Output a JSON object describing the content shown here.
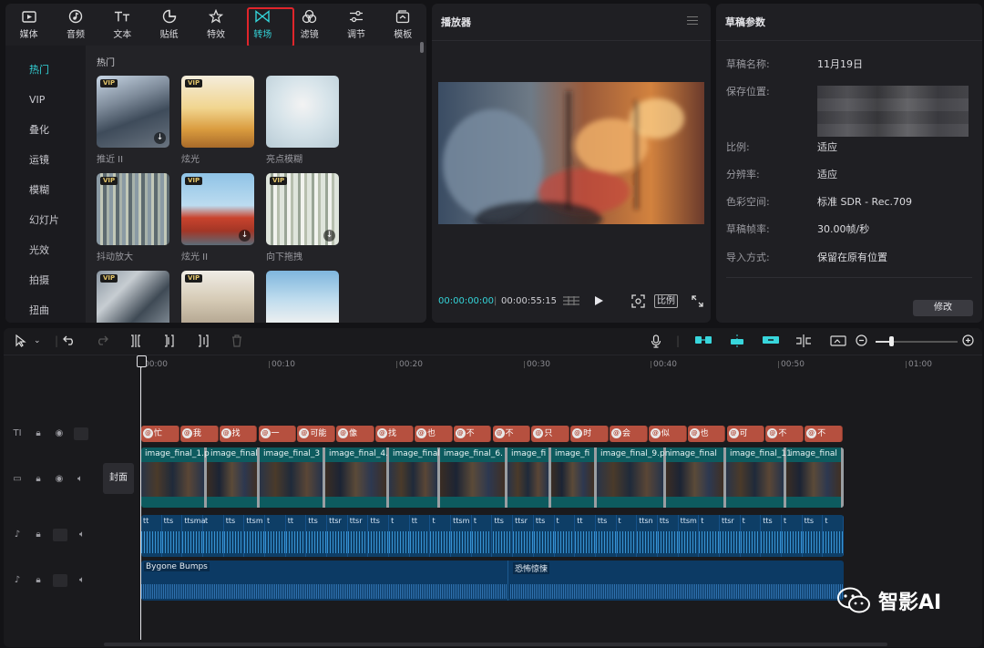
{
  "media_toolbar": {
    "tools": [
      {
        "label": "媒体",
        "icon": "media-icon"
      },
      {
        "label": "音频",
        "icon": "audio-icon"
      },
      {
        "label": "文本",
        "icon": "text-icon"
      },
      {
        "label": "贴纸",
        "icon": "sticker-icon"
      },
      {
        "label": "特效",
        "icon": "effect-icon"
      },
      {
        "label": "转场",
        "icon": "transition-icon",
        "active": true
      },
      {
        "label": "滤镜",
        "icon": "filter-icon"
      },
      {
        "label": "调节",
        "icon": "adjust-icon"
      },
      {
        "label": "模板",
        "icon": "template-icon"
      }
    ]
  },
  "sidebar": {
    "items": [
      {
        "label": "热门",
        "active": true
      },
      {
        "label": "VIP"
      },
      {
        "label": "叠化"
      },
      {
        "label": "运镜"
      },
      {
        "label": "模糊"
      },
      {
        "label": "幻灯片"
      },
      {
        "label": "光效"
      },
      {
        "label": "拍摄"
      },
      {
        "label": "扭曲"
      }
    ]
  },
  "transitions": {
    "section_title": "热门",
    "items": [
      {
        "label": "推近 II",
        "vip": true,
        "download": true
      },
      {
        "label": "炫光",
        "vip": true,
        "download": false
      },
      {
        "label": "亮点模糊",
        "vip": false,
        "download": false
      },
      {
        "label": "抖动放大",
        "vip": true,
        "download": false
      },
      {
        "label": "炫光 II",
        "vip": true,
        "download": true
      },
      {
        "label": "向下拖拽",
        "vip": true,
        "download": true
      },
      {
        "label": "",
        "vip": true,
        "download": false
      },
      {
        "label": "",
        "vip": true,
        "download": false
      },
      {
        "label": "",
        "vip": false,
        "download": false
      }
    ],
    "vip_badge": "VIP",
    "download_glyph": "↓"
  },
  "player": {
    "title": "播放器",
    "current_time": "00:00:00:00",
    "total_time": "00:00:55:15",
    "ratio_label": "比例"
  },
  "draft": {
    "title": "草稿参数",
    "rows": [
      {
        "key": "草稿名称:",
        "value": "11月19日"
      },
      {
        "key": "保存位置:",
        "value": ""
      },
      {
        "key": "比例:",
        "value": "适应"
      },
      {
        "key": "分辨率:",
        "value": "适应"
      },
      {
        "key": "色彩空间:",
        "value": "标准 SDR - Rec.709"
      },
      {
        "key": "草稿帧率:",
        "value": "30.00帧/秒"
      },
      {
        "key": "导入方式:",
        "value": "保留在原有位置"
      }
    ],
    "edit_button": "修改"
  },
  "timeline": {
    "ruler": [
      "00:00",
      "00:10",
      "00:20",
      "00:30",
      "00:40",
      "00:50",
      "01:00"
    ],
    "cover_label": "封面",
    "text_clips": [
      "忙",
      "我",
      "找",
      "一",
      "可能",
      "像",
      "找",
      "也",
      "不",
      "不",
      "只",
      "时",
      "会",
      "似",
      "也",
      "可",
      "不",
      "不"
    ],
    "video_clips": [
      "image_final_1.p",
      "image_final",
      "image_final_3",
      "image_final_4.",
      "image_final",
      "image_final_6.",
      "image_fi",
      "image_fi",
      "image_final_9.pn",
      "image_final",
      "image_final_11",
      "image_final"
    ],
    "audio_clips": [
      "tt",
      "tts",
      "ttsma",
      "t",
      "tts",
      "ttsm",
      "t",
      "tt",
      "tts",
      "ttsr",
      "ttsr",
      "tts",
      "t",
      "tt",
      "t",
      "ttsm",
      "t",
      "tts",
      "ttsr",
      "tts",
      "t",
      "tt",
      "tts",
      "t",
      "ttsn",
      "tts",
      "ttsm",
      "t",
      "ttsr",
      "t",
      "tts",
      "t",
      "tts",
      "t"
    ],
    "music_clips": [
      {
        "label": "Bygone Bumps"
      },
      {
        "label": "恐怖惊悚"
      }
    ]
  },
  "watermark": {
    "text": "智影AI"
  }
}
